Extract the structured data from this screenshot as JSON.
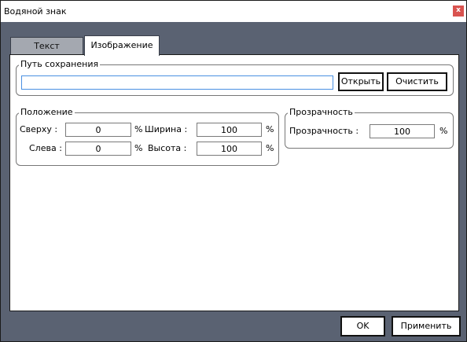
{
  "window": {
    "title": "Водяной знак",
    "close_glyph": "x"
  },
  "tabs": [
    {
      "label": "Текст",
      "active": false
    },
    {
      "label": "Изображение",
      "active": true
    }
  ],
  "save_path": {
    "group_title": "Путь сохранения",
    "value": "",
    "open_label": "Открыть",
    "clear_label": "Очистить"
  },
  "position": {
    "group_title": "Положение",
    "top_label": "Сверху :",
    "top_value": "0",
    "left_label": "Слева :",
    "left_value": "0",
    "width_label": "Ширина :",
    "width_value": "100",
    "height_label": "Высота :",
    "height_value": "100",
    "percent": "%"
  },
  "transparency": {
    "group_title": "Прозрачность",
    "label": "Прозрачность :",
    "value": "100",
    "percent": "%"
  },
  "footer": {
    "ok_label": "OK",
    "apply_label": "Применить"
  },
  "colors": {
    "frame": "#5a6272",
    "inactive_tab": "#a4a8b0",
    "close": "#d9534f"
  }
}
